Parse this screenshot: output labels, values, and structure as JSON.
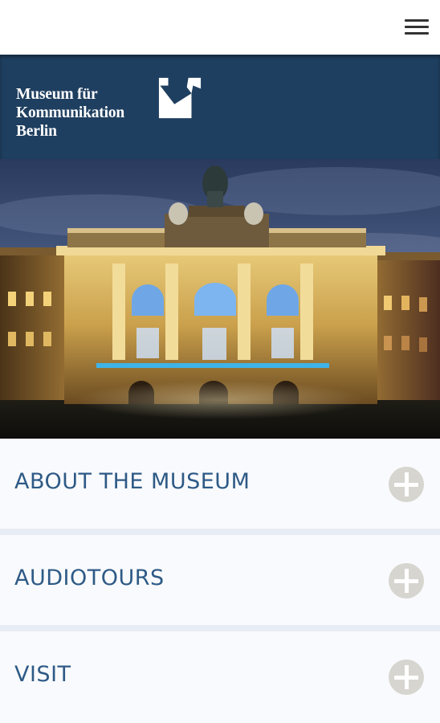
{
  "topbar": {
    "menu_icon": "hamburger-menu-icon"
  },
  "brand": {
    "line1": "Museum für",
    "line2": "Kommunikation",
    "line3": "Berlin",
    "background_color": "#1f3f60",
    "logo_icon": "museum-logo-mark"
  },
  "hero": {
    "image": "Museum building facade illuminated at night"
  },
  "sections": {
    "items": [
      {
        "label": "ABOUT THE MUSEUM",
        "icon": "plus-circle-icon"
      },
      {
        "label": "AUDIOTOURS",
        "icon": "plus-circle-icon"
      },
      {
        "label": "VISIT",
        "icon": "plus-circle-icon"
      }
    ],
    "label_color": "#2e5a86",
    "icon_color": "#d6d5cf"
  }
}
